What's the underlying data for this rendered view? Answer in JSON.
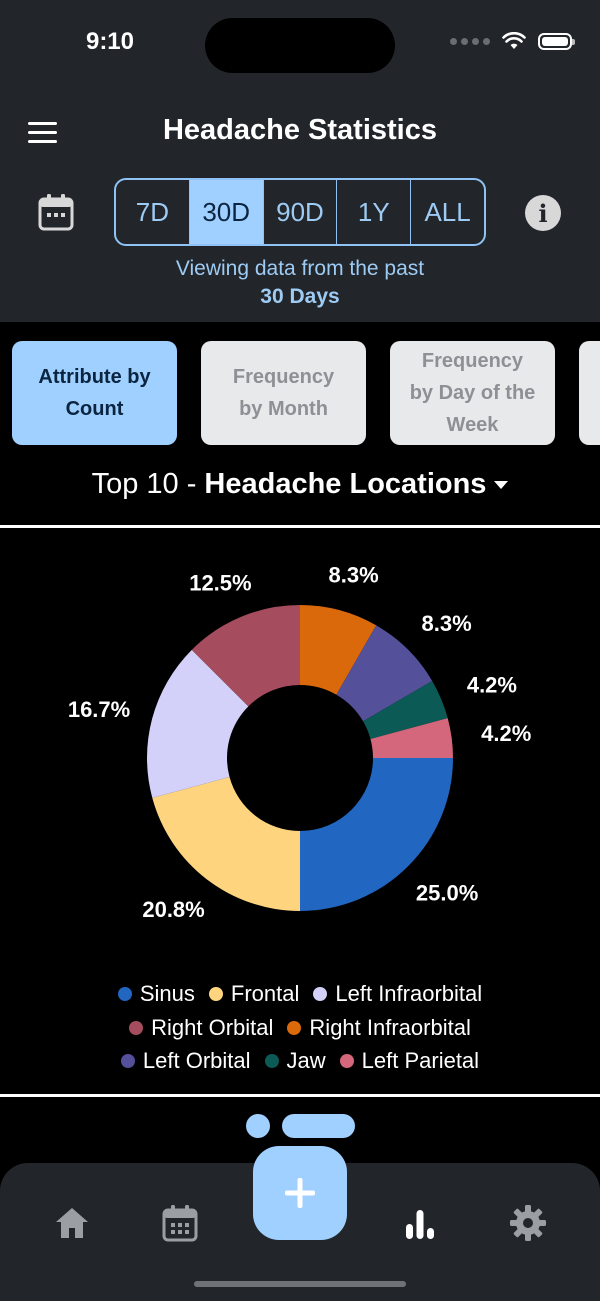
{
  "status_bar": {
    "time": "9:10"
  },
  "header": {
    "title": "Headache Statistics",
    "ranges": [
      "7D",
      "30D",
      "90D",
      "1Y",
      "ALL"
    ],
    "active_range": "30D",
    "viewing_text": "Viewing data from the past",
    "viewing_period": "30 Days"
  },
  "chips": [
    {
      "line1": "Attribute by",
      "line2": "Count",
      "active": true
    },
    {
      "line1": "Frequency",
      "line2": "by Month",
      "active": false
    },
    {
      "line1": "Frequency",
      "line2": "by Day of the",
      "line3": "Week",
      "active": false
    }
  ],
  "section": {
    "prefix": "Top 10 - ",
    "title": "Headache Locations"
  },
  "chart_data": {
    "type": "pie",
    "donut": true,
    "categories": [
      "Sinus",
      "Frontal",
      "Left Infraorbital",
      "Right Orbital",
      "Right Infraorbital",
      "Left Orbital",
      "Jaw",
      "Left Parietal"
    ],
    "values": [
      25.0,
      20.8,
      16.7,
      12.5,
      8.3,
      8.3,
      4.2,
      4.2
    ],
    "labels": [
      "25.0%",
      "20.8%",
      "16.7%",
      "12.5%",
      "8.3%",
      "8.3%",
      "4.2%",
      "4.2%"
    ],
    "colors": [
      "#2166c0",
      "#fed57e",
      "#d3d0f9",
      "#a54d5e",
      "#d9690a",
      "#55509a",
      "#0b5a55",
      "#d4677b"
    ],
    "legend_position": "bottom"
  },
  "tabs": [
    {
      "name": "home-icon"
    },
    {
      "name": "calendar-icon"
    },
    {
      "name": "add-icon"
    },
    {
      "name": "chart-icon"
    },
    {
      "name": "gear-icon"
    }
  ]
}
